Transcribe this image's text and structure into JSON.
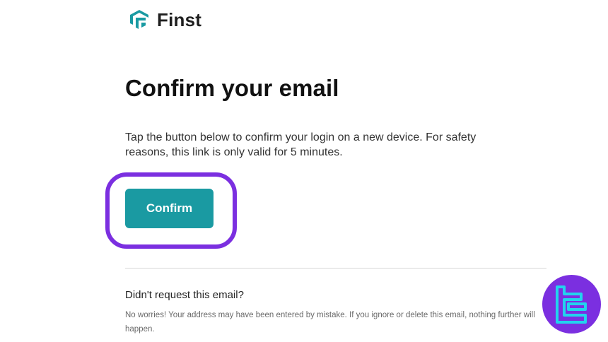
{
  "brand": {
    "name": "Finst",
    "logo_color": "#1a9aa2"
  },
  "email": {
    "title": "Confirm your email",
    "instructions": "Tap the button below to confirm your login on a new device. For safety reasons, this link is only valid for 5 minutes.",
    "confirm_label": "Confirm",
    "button_color": "#1a9aa2",
    "highlight_color": "#7b2fe0"
  },
  "footer": {
    "heading": "Didn't request this email?",
    "text": "No worries! Your address may have been entered by mistake. If you ignore or delete this email, nothing further will happen."
  },
  "watermark": {
    "icon": "tradingfinder-logo-icon",
    "color": "#7b2fe0"
  }
}
